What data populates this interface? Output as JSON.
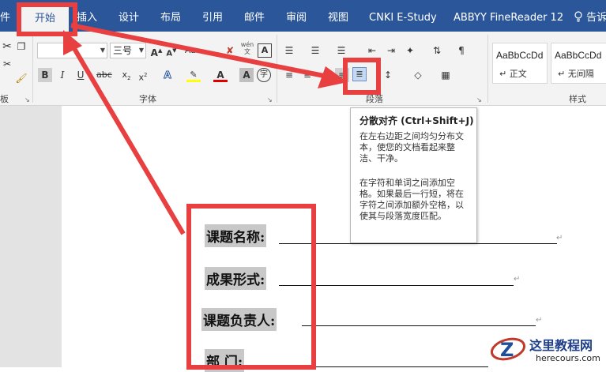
{
  "ribbon_tabs": [
    "件",
    "开始",
    "插入",
    "设计",
    "布局",
    "引用",
    "邮件",
    "审阅",
    "视图",
    "CNKI E-Study",
    "ABBYY FineReader 12",
    "告诉"
  ],
  "tell_me_icon": "lightbulb-icon",
  "font": {
    "name_value": "",
    "size_value": "三号",
    "phonetic_glyph": "wén",
    "group_label": "字体"
  },
  "clipboard": {
    "group_label": "剪贴板",
    "visible_label": "板"
  },
  "paragraph": {
    "group_label": "段落"
  },
  "styles": {
    "group_label": "样式",
    "items": [
      {
        "sample": "AaBbCcDd",
        "name": "正文"
      },
      {
        "sample": "AaBbCcDd",
        "name": "无间隔"
      }
    ]
  },
  "tooltip": {
    "title": "分散对齐 (Ctrl+Shift+J)",
    "para1": "在左右边距之间均匀分布文本，使您的文档看起来整洁、干净。",
    "para2": "在字符和单词之间添加空格。如果最后一行短，将在字符之间添加额外空格，以使其与段落宽度匹配。"
  },
  "document": {
    "fields": [
      {
        "label": "课题名称:"
      },
      {
        "label": "成果形式:"
      },
      {
        "label": "课题负责人:"
      },
      {
        "label": "部  门:"
      }
    ]
  },
  "watermark": {
    "cn": "这里教程网",
    "url": "herecours.com",
    "logo": "z-logo-icon"
  },
  "colors": {
    "ribbon_tab_bg": "#2b579a",
    "ribbon_bg": "#f3f3f3",
    "annotation_red": "#e84040",
    "highlight_gray": "#c8c8c8"
  }
}
